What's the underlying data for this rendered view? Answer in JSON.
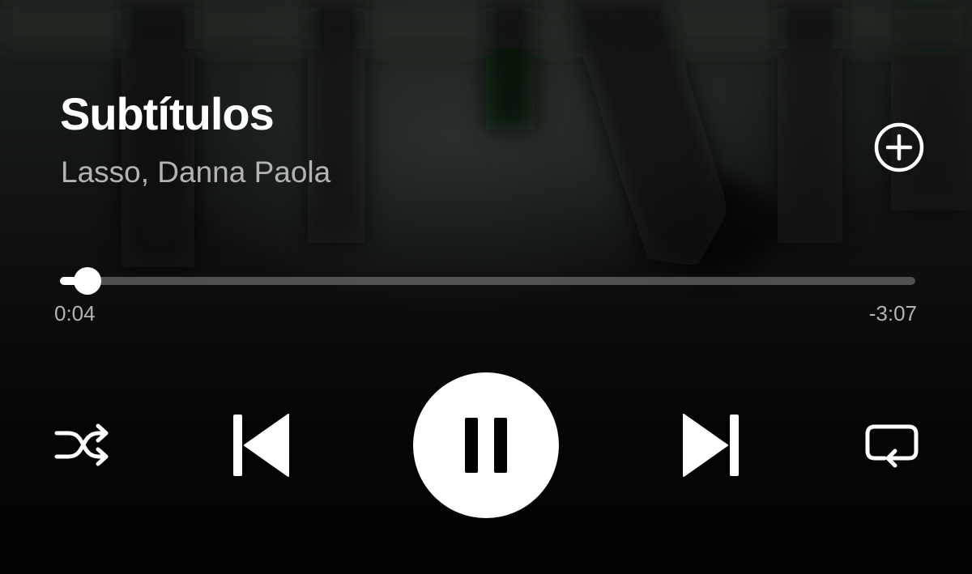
{
  "track": {
    "title": "Subtítulos",
    "artist": "Lasso, Danna Paola"
  },
  "playback": {
    "elapsed": "0:04",
    "remaining": "-3:07",
    "progress_fraction": 0.0214,
    "state": "playing"
  },
  "icons": {
    "add": "add-circle-icon",
    "shuffle": "shuffle-icon",
    "previous": "skip-previous-icon",
    "pause": "pause-icon",
    "next": "skip-next-icon",
    "repeat": "repeat-icon"
  },
  "colors": {
    "text_primary": "#ffffff",
    "text_secondary": "#b3b3b3",
    "track_inactive": "rgba(255,255,255,0.28)",
    "accent": "#ffffff"
  }
}
